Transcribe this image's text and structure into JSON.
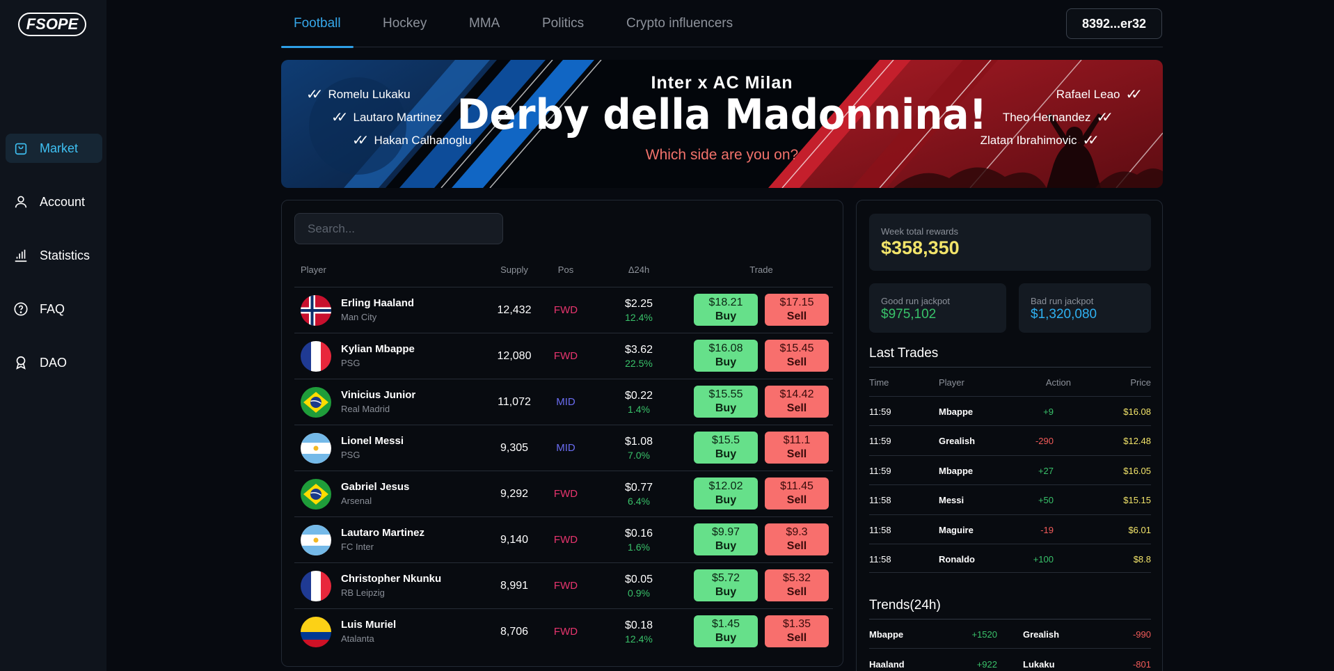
{
  "brand": {
    "logo": "FSOPE"
  },
  "sidebar": {
    "items": [
      {
        "label": "Market",
        "icon": "shopping-bag-icon",
        "active": true
      },
      {
        "label": "Account",
        "icon": "user-icon",
        "active": false
      },
      {
        "label": "Statistics",
        "icon": "bar-chart-icon",
        "active": false
      },
      {
        "label": "FAQ",
        "icon": "help-circle-icon",
        "active": false
      },
      {
        "label": "DAO",
        "icon": "award-icon",
        "active": false
      }
    ]
  },
  "tabs": [
    {
      "label": "Football",
      "active": true
    },
    {
      "label": "Hockey",
      "active": false
    },
    {
      "label": "MMA",
      "active": false
    },
    {
      "label": "Politics",
      "active": false
    },
    {
      "label": "Crypto influencers",
      "active": false
    }
  ],
  "wallet": {
    "address": "8392...er32"
  },
  "banner": {
    "subtitle": "Inter x AC Milan",
    "title": "Derby della Madonnina!",
    "question": "Which side are you on?",
    "left_players": [
      "Romelu Lukaku",
      "Lautaro Martinez",
      "Hakan Calhanoglu"
    ],
    "right_players": [
      "Rafael Leao",
      "Theo Hernandez",
      "Zlatan Ibrahimovic"
    ]
  },
  "market": {
    "search_placeholder": "Search...",
    "headers": {
      "player": "Player",
      "supply": "Supply",
      "pos": "Pos",
      "change": "Δ24h",
      "trade": "Trade"
    },
    "buy_label": "Buy",
    "sell_label": "Sell",
    "rows": [
      {
        "name": "Erling Haaland",
        "club": "Man City",
        "flag": "norway",
        "supply": "12,432",
        "pos": "FWD",
        "price": "$2.25",
        "change": "12.4%",
        "buy": "$18.21",
        "sell": "$17.15"
      },
      {
        "name": "Kylian Mbappe",
        "club": "PSG",
        "flag": "france",
        "supply": "12,080",
        "pos": "FWD",
        "price": "$3.62",
        "change": "22.5%",
        "buy": "$16.08",
        "sell": "$15.45"
      },
      {
        "name": "Vinicius Junior",
        "club": "Real Madrid",
        "flag": "brazil",
        "supply": "11,072",
        "pos": "MID",
        "price": "$0.22",
        "change": "1.4%",
        "buy": "$15.55",
        "sell": "$14.42"
      },
      {
        "name": "Lionel Messi",
        "club": "PSG",
        "flag": "argentina",
        "supply": "9,305",
        "pos": "MID",
        "price": "$1.08",
        "change": "7.0%",
        "buy": "$15.5",
        "sell": "$11.1"
      },
      {
        "name": "Gabriel Jesus",
        "club": "Arsenal",
        "flag": "brazil",
        "supply": "9,292",
        "pos": "FWD",
        "price": "$0.77",
        "change": "6.4%",
        "buy": "$12.02",
        "sell": "$11.45"
      },
      {
        "name": "Lautaro Martinez",
        "club": "FC Inter",
        "flag": "argentina",
        "supply": "9,140",
        "pos": "FWD",
        "price": "$0.16",
        "change": "1.6%",
        "buy": "$9.97",
        "sell": "$9.3"
      },
      {
        "name": "Christopher Nkunku",
        "club": "RB Leipzig",
        "flag": "france",
        "supply": "8,991",
        "pos": "FWD",
        "price": "$0.05",
        "change": "0.9%",
        "buy": "$5.72",
        "sell": "$5.32"
      },
      {
        "name": "Luis Muriel",
        "club": "Atalanta",
        "flag": "colombia",
        "supply": "8,706",
        "pos": "FWD",
        "price": "$0.18",
        "change": "12.4%",
        "buy": "$1.45",
        "sell": "$1.35"
      }
    ]
  },
  "stats": {
    "week_rewards_label": "Week total rewards",
    "week_rewards": "$358,350",
    "good_jackpot_label": "Good run jackpot",
    "good_jackpot": "$975,102",
    "bad_jackpot_label": "Bad run jackpot",
    "bad_jackpot": "$1,320,080"
  },
  "last_trades": {
    "title": "Last Trades",
    "headers": {
      "time": "Time",
      "player": "Player",
      "action": "Action",
      "price": "Price"
    },
    "rows": [
      {
        "time": "11:59",
        "player": "Mbappe",
        "action": "+9",
        "price": "$16.08"
      },
      {
        "time": "11:59",
        "player": "Grealish",
        "action": "-290",
        "price": "$12.48"
      },
      {
        "time": "11:59",
        "player": "Mbappe",
        "action": "+27",
        "price": "$16.05"
      },
      {
        "time": "11:58",
        "player": "Messi",
        "action": "+50",
        "price": "$15.15"
      },
      {
        "time": "11:58",
        "player": "Maguire",
        "action": "-19",
        "price": "$6.01"
      },
      {
        "time": "11:58",
        "player": "Ronaldo",
        "action": "+100",
        "price": "$8.8"
      }
    ]
  },
  "trends": {
    "title": "Trends(24h)",
    "rows": [
      {
        "up_player": "Mbappe",
        "up_value": "+1520",
        "down_player": "Grealish",
        "down_value": "-990"
      },
      {
        "up_player": "Haaland",
        "up_value": "+922",
        "down_player": "Lukaku",
        "down_value": "-801"
      }
    ]
  },
  "colors": {
    "accent": "#36a7ea",
    "buy": "#66e08a",
    "sell": "#f86f6d",
    "positive": "#39c26a",
    "negative": "#f25b59",
    "price_yellow": "#f2e46a",
    "pos_fwd": "#e8356e",
    "pos_mid": "#6a6cf0"
  }
}
